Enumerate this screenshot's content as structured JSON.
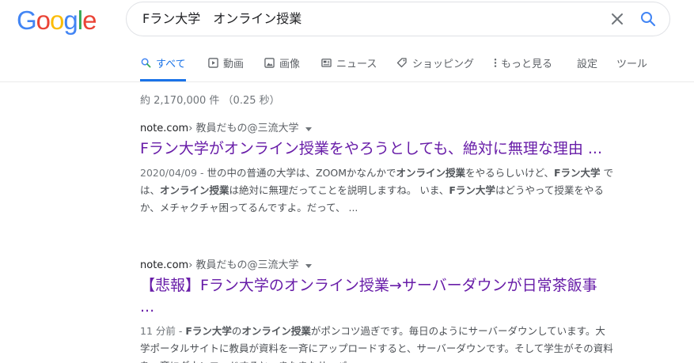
{
  "logo": {
    "letters": [
      "G",
      "o",
      "o",
      "g",
      "l",
      "e"
    ],
    "colors": [
      "#4285F4",
      "#EA4335",
      "#FBBC05",
      "#4285F4",
      "#34A853",
      "#EA4335"
    ]
  },
  "search": {
    "query": "Fラン大学　オンライン授業",
    "clear_icon": "close-icon",
    "search_icon": "search-icon"
  },
  "tabs": [
    {
      "label": "すべて",
      "icon": "search-icon",
      "active": true
    },
    {
      "label": "動画",
      "icon": "video-icon",
      "active": false
    },
    {
      "label": "画像",
      "icon": "image-icon",
      "active": false
    },
    {
      "label": "ニュース",
      "icon": "news-icon",
      "active": false
    },
    {
      "label": "ショッピング",
      "icon": "tag-icon",
      "active": false
    },
    {
      "label": "もっと見る",
      "icon": "more-vert-icon",
      "active": false
    },
    {
      "label": "設定",
      "icon": "",
      "active": false
    },
    {
      "label": "ツール",
      "icon": "",
      "active": false
    }
  ],
  "stats": "約 2,170,000 件 （0.25 秒）",
  "colors": {
    "accent": "#1a73e8",
    "visited_link": "#681da8",
    "muted": "#70757a"
  },
  "results": [
    {
      "site": "note.com",
      "crumb": " › 教員だもの@三流大学",
      "title": "Fラン大学がオンライン授業をやろうとしても、絶対に無理な理由 ...",
      "snippet": [
        {
          "t": "2020/04/09 - ",
          "cls": "date"
        },
        {
          "t": "世の中の普通の大学は、ZOOMかなんかで"
        },
        {
          "t": "オンライン授業",
          "b": true
        },
        {
          "t": "をやるらしいけど、"
        },
        {
          "t": "Fラン大学",
          "b": true
        },
        {
          "t": " では、"
        },
        {
          "t": "オンライン授業",
          "b": true
        },
        {
          "t": "は絶対に無理だってことを説明しますね。 いま、"
        },
        {
          "t": "Fラン大学",
          "b": true
        },
        {
          "t": "はどうやって授業をやるか、メチャクチャ困ってるんですよ。だって、 ..."
        }
      ]
    },
    {
      "site": "note.com",
      "crumb": " › 教員だもの@三流大学",
      "title": "【悲報】Fラン大学のオンライン授業→サーバーダウンが日常茶飯事 ...",
      "snippet": [
        {
          "t": "11 分前 - ",
          "cls": "date"
        },
        {
          "t": "Fラン大学",
          "b": true
        },
        {
          "t": "の"
        },
        {
          "t": "オンライン授業",
          "b": true
        },
        {
          "t": "がポンコツ過ぎです。毎日のようにサーバーダウンしています。大学ポータルサイトに教員が資料を一斉にアップロードすると、サーバーダウンです。そして学生がその資料を一斉にダウンロードすると、またまたサーバー ..."
        }
      ]
    }
  ]
}
